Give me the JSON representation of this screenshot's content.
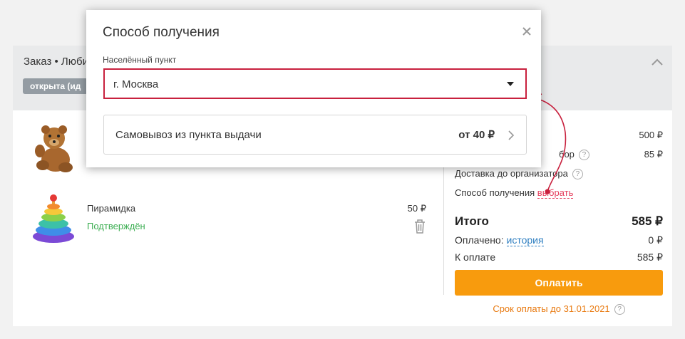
{
  "order": {
    "title": "Заказ • Люби",
    "badge": "открыта (ид",
    "products": [
      {
        "name": "",
        "status": "",
        "price": ""
      },
      {
        "name": "Пирамидка",
        "status": "Подтверждён",
        "price": "50 ₽"
      }
    ],
    "summary": {
      "row1": {
        "label": "",
        "value": "500 ₽"
      },
      "row2": {
        "label": "бор",
        "value": "85 ₽"
      },
      "delivery_label": "Доставка до организатора",
      "method_label": "Способ получения",
      "method_link": "выбрать",
      "total_label": "Итого",
      "total_value": "585 ₽",
      "paid_label": "Оплачено:",
      "paid_link": "история",
      "paid_value": "0 ₽",
      "due_label": "К оплате",
      "due_value": "585 ₽"
    },
    "pay_button": "Оплатить",
    "deadline": "Срок оплаты до 31.01.2021"
  },
  "modal": {
    "title": "Способ получения",
    "field_label": "Населённый пункт",
    "city_value": "г. Москва",
    "pickup_label": "Самовывоз из пункта выдачи",
    "pickup_price": "от 40 ₽"
  },
  "colors": {
    "accent_orange": "#f89b0d",
    "highlight_red": "#c8213e",
    "status_green": "#3cae52",
    "link_blue": "#2f7fc1",
    "header_gray": "#e9eaeb"
  },
  "icons": [
    "close-icon",
    "caret-down-icon",
    "chevron-right-icon",
    "chevron-up-icon",
    "trash-icon",
    "question-icon"
  ]
}
